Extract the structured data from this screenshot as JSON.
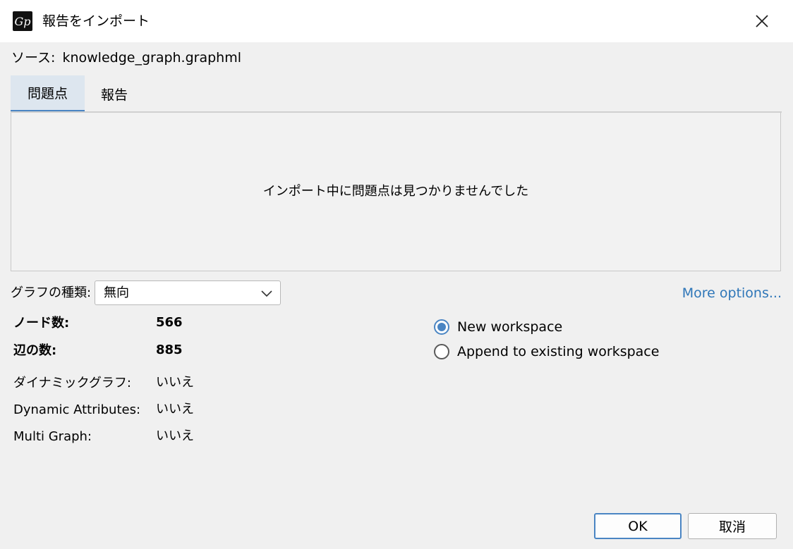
{
  "window": {
    "title": "報告をインポート",
    "icon": "gephi-app-icon",
    "icon_glyph": "Gp",
    "close_icon": "close-icon"
  },
  "source": {
    "label": "ソース:",
    "value": "knowledge_graph.graphml"
  },
  "tabs": [
    {
      "label": "問題点",
      "active": true
    },
    {
      "label": "報告",
      "active": false
    }
  ],
  "issues_panel": {
    "message": "インポート中に問題点は見つかりませんでした"
  },
  "graph_type": {
    "label": "グラフの種類:",
    "selected": "無向"
  },
  "more_options": "More options...",
  "stats": [
    {
      "label": "ノード数:",
      "value": "566",
      "bold": true
    },
    {
      "label": "辺の数:",
      "value": "885",
      "bold": true
    },
    {
      "label": "ダイナミックグラフ:",
      "value": "いいえ",
      "bold": false
    },
    {
      "label": "Dynamic Attributes:",
      "value": "いいえ",
      "bold": false
    },
    {
      "label": "Multi Graph:",
      "value": "いいえ",
      "bold": false
    }
  ],
  "workspace_options": [
    {
      "label": "New workspace",
      "checked": true
    },
    {
      "label": "Append to existing workspace",
      "checked": false
    }
  ],
  "buttons": {
    "ok": "OK",
    "cancel": "取消"
  },
  "colors": {
    "accent": "#4a85c3",
    "link": "#2e76b8",
    "active_tab_bg": "#dde6ef"
  }
}
